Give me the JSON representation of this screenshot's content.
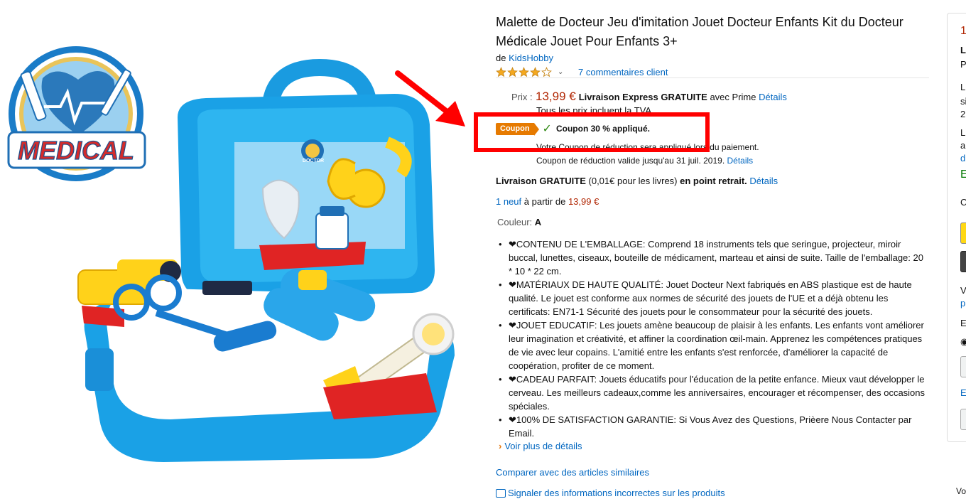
{
  "product": {
    "title": "Malette de Docteur Jeu d'imitation Jouet Docteur Enfants Kit du Docteur Médicale Jouet Pour Enfants 3+",
    "by_prefix": "de",
    "brand": "KidsHobby",
    "rating": 4,
    "rating_max": 5,
    "reviews_link": "7 commentaires client"
  },
  "image": {
    "logo_text": "MEDICAL",
    "case_label": "DOCTOR"
  },
  "price": {
    "label": "Prix :",
    "value": "13,99 €",
    "shipping": "Livraison Express GRATUITE",
    "prime_text": "avec Prime",
    "details": "Détails",
    "tva": "Tous les prix incluent la TVA."
  },
  "coupon": {
    "badge": "Coupon",
    "applied": "Coupon 30 % appliqué.",
    "note": "Votre Coupon de réduction sera appliqué lors du paiement.",
    "valid": "Coupon de réduction valide jusqu'au 31 juil. 2019.",
    "details": "Détails"
  },
  "delivery": {
    "free": "Livraison GRATUITE",
    "paren": "(0,01€ pour les livres)",
    "point": "en point retrait.",
    "details": "Détails"
  },
  "offers": {
    "link": "1 neuf",
    "text": "à partir de",
    "price": "13,99 €"
  },
  "color": {
    "label": "Couleur:",
    "value": "A"
  },
  "bullets": [
    "❤CONTENU DE L'EMBALLAGE: Comprend 18 instruments tels que seringue, projecteur, miroir buccal, lunettes, ciseaux, bouteille de médicament, marteau et ainsi de suite. Taille de l'emballage: 20 * 10 * 22 cm.",
    "❤MATÉRIAUX DE HAUTE QUALITÉ: Jouet Docteur Next fabriqués en ABS plastique est de haute qualité. Le jouet est conforme aux normes de sécurité des jouets de l'UE et a déjà obtenu les certificats: EN71-1 Sécurité des jouets pour le consommateur pour la sécurité des jouets.",
    "❤JOUET EDUCATIF: Les jouets amène beaucoup de plaisir à les enfants. Les enfants vont améliorer leur imagination et créativité, et affiner la coordination œil-main. Apprenez les compétences pratiques de vie avec leur copains. L'amitié entre les enfants s'est renforcée, d'améliorer la capacité de coopération, profiter de ce moment.",
    "❤CADEAU PARFAIT: Jouets éducatifs pour l'éducation de la petite enfance. Mieux vaut développer le cerveau. Les meilleurs cadeaux,comme les anniversaires, encourager et récompenser, des occasions spéciales.",
    "❤100% DE SATISFACTION GARANTIE: Si Vous Avez des Questions, Prièere Nous Contacter par Email."
  ],
  "links": {
    "voir_plus": "Voir plus de détails",
    "comparer": "Comparer avec des articles similaires",
    "signaler": "Signaler des informations incorrectes sur les produits"
  },
  "buybox": {
    "price_partial": "1",
    "lines": [
      "L",
      "P",
      "L",
      "si",
      "2",
      "L",
      "a",
      "d",
      "E",
      "C",
      "V",
      "p",
      "E",
      "E"
    ],
    "bottom": "Vo"
  },
  "colors": {
    "link": "#0066c0",
    "price": "#b12704",
    "coupon_badge": "#e67a00",
    "highlight": "#ff0000",
    "star": "#f4a81f"
  }
}
